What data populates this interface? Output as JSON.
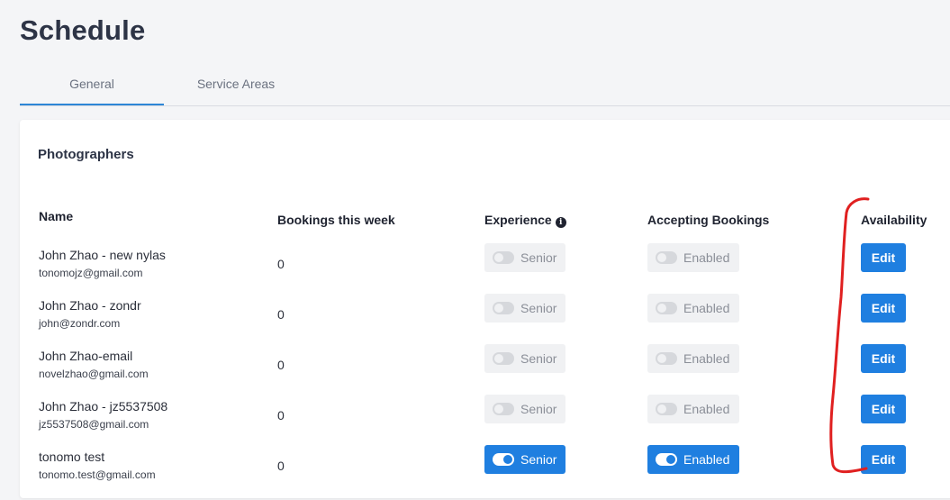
{
  "page": {
    "title": "Schedule"
  },
  "tabs": [
    {
      "label": "General",
      "active": true
    },
    {
      "label": "Service Areas",
      "active": false
    }
  ],
  "section": {
    "title": "Photographers"
  },
  "columns": {
    "name": "Name",
    "bookings": "Bookings this week",
    "experience": "Experience",
    "accepting": "Accepting Bookings",
    "availability": "Availability"
  },
  "icons": {
    "experience_info": "info-icon",
    "toggle": "toggle-switch-icon"
  },
  "rows": [
    {
      "name": "John Zhao - new nylas",
      "email": "tonomojz@gmail.com",
      "bookings": "0",
      "experience": "Senior",
      "experience_on": false,
      "accepting": "Enabled",
      "accepting_on": false,
      "edit": "Edit"
    },
    {
      "name": "John Zhao - zondr",
      "email": "john@zondr.com",
      "bookings": "0",
      "experience": "Senior",
      "experience_on": false,
      "accepting": "Enabled",
      "accepting_on": false,
      "edit": "Edit"
    },
    {
      "name": "John Zhao-email",
      "email": "novelzhao@gmail.com",
      "bookings": "0",
      "experience": "Senior",
      "experience_on": false,
      "accepting": "Enabled",
      "accepting_on": false,
      "edit": "Edit"
    },
    {
      "name": "John Zhao - jz5537508",
      "email": "jz5537508@gmail.com",
      "bookings": "0",
      "experience": "Senior",
      "experience_on": false,
      "accepting": "Enabled",
      "accepting_on": false,
      "edit": "Edit"
    },
    {
      "name": "tonomo test",
      "email": "tonomo.test@gmail.com",
      "bookings": "0",
      "experience": "Senior",
      "experience_on": true,
      "accepting": "Enabled",
      "accepting_on": true,
      "edit": "Edit"
    }
  ],
  "colors": {
    "primary": "#1f7fe0",
    "annotation": "#e02020",
    "tab_underline": "#2d86d6"
  }
}
